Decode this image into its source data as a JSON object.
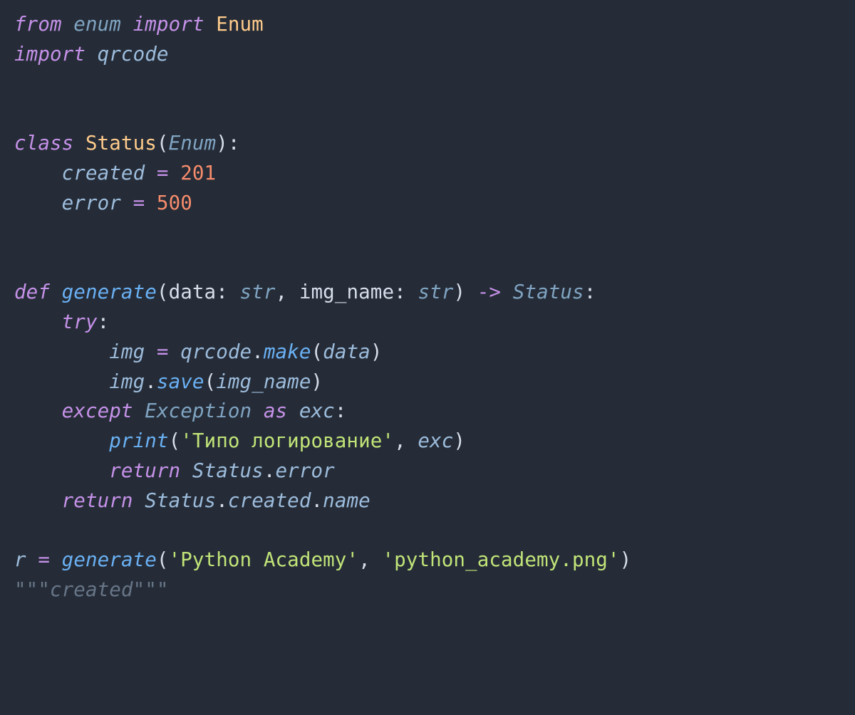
{
  "code": {
    "lines": [
      [
        {
          "t": "from ",
          "c": "kw-ctrl"
        },
        {
          "t": "enum ",
          "c": "type"
        },
        {
          "t": "import ",
          "c": "kw-ctrl"
        },
        {
          "t": "Enum",
          "c": "classname"
        }
      ],
      [
        {
          "t": "import ",
          "c": "kw-ctrl"
        },
        {
          "t": "qrcode",
          "c": "var"
        }
      ],
      [],
      [],
      [
        {
          "t": "class ",
          "c": "kw-ctrl"
        },
        {
          "t": "Status",
          "c": "classname"
        },
        {
          "t": "(",
          "c": "punct"
        },
        {
          "t": "Enum",
          "c": "typeuse"
        },
        {
          "t": "):",
          "c": "punct"
        }
      ],
      [
        {
          "t": "    ",
          "c": "punct"
        },
        {
          "t": "created ",
          "c": "var"
        },
        {
          "t": "= ",
          "c": "op"
        },
        {
          "t": "201",
          "c": "num"
        }
      ],
      [
        {
          "t": "    ",
          "c": "punct"
        },
        {
          "t": "error ",
          "c": "var"
        },
        {
          "t": "= ",
          "c": "op"
        },
        {
          "t": "500",
          "c": "num"
        }
      ],
      [],
      [],
      [
        {
          "t": "def ",
          "c": "kw-ctrl"
        },
        {
          "t": "generate",
          "c": "funcdef"
        },
        {
          "t": "(",
          "c": "punct"
        },
        {
          "t": "data",
          "c": "param"
        },
        {
          "t": ": ",
          "c": "punct"
        },
        {
          "t": "str",
          "c": "type"
        },
        {
          "t": ", ",
          "c": "punct"
        },
        {
          "t": "img_name",
          "c": "param"
        },
        {
          "t": ": ",
          "c": "punct"
        },
        {
          "t": "str",
          "c": "type"
        },
        {
          "t": ") ",
          "c": "punct"
        },
        {
          "t": "-> ",
          "c": "op"
        },
        {
          "t": "Status",
          "c": "typeuse"
        },
        {
          "t": ":",
          "c": "punct"
        }
      ],
      [
        {
          "t": "    ",
          "c": "punct"
        },
        {
          "t": "try",
          "c": "kw-ctrl"
        },
        {
          "t": ":",
          "c": "punct"
        }
      ],
      [
        {
          "t": "        ",
          "c": "punct"
        },
        {
          "t": "img ",
          "c": "var"
        },
        {
          "t": "= ",
          "c": "op"
        },
        {
          "t": "qrcode",
          "c": "var"
        },
        {
          "t": ".",
          "c": "punct"
        },
        {
          "t": "make",
          "c": "method"
        },
        {
          "t": "(",
          "c": "punct"
        },
        {
          "t": "data",
          "c": "var"
        },
        {
          "t": ")",
          "c": "punct"
        }
      ],
      [
        {
          "t": "        ",
          "c": "punct"
        },
        {
          "t": "img",
          "c": "var"
        },
        {
          "t": ".",
          "c": "punct"
        },
        {
          "t": "save",
          "c": "method"
        },
        {
          "t": "(",
          "c": "punct"
        },
        {
          "t": "img_name",
          "c": "var"
        },
        {
          "t": ")",
          "c": "punct"
        }
      ],
      [
        {
          "t": "    ",
          "c": "punct"
        },
        {
          "t": "except ",
          "c": "kw-ctrl"
        },
        {
          "t": "Exception ",
          "c": "typeuse"
        },
        {
          "t": "as ",
          "c": "kw-ctrl"
        },
        {
          "t": "exc",
          "c": "var"
        },
        {
          "t": ":",
          "c": "punct"
        }
      ],
      [
        {
          "t": "        ",
          "c": "punct"
        },
        {
          "t": "print",
          "c": "funccall"
        },
        {
          "t": "(",
          "c": "punct"
        },
        {
          "t": "'Типо логирование'",
          "c": "str"
        },
        {
          "t": ", ",
          "c": "punct"
        },
        {
          "t": "exc",
          "c": "var"
        },
        {
          "t": ")",
          "c": "punct"
        }
      ],
      [
        {
          "t": "        ",
          "c": "punct"
        },
        {
          "t": "return ",
          "c": "kw-ctrl"
        },
        {
          "t": "Status",
          "c": "var"
        },
        {
          "t": ".",
          "c": "punct"
        },
        {
          "t": "error",
          "c": "var"
        }
      ],
      [
        {
          "t": "    ",
          "c": "punct"
        },
        {
          "t": "return ",
          "c": "kw-ctrl"
        },
        {
          "t": "Status",
          "c": "var"
        },
        {
          "t": ".",
          "c": "punct"
        },
        {
          "t": "created",
          "c": "var"
        },
        {
          "t": ".",
          "c": "punct"
        },
        {
          "t": "name",
          "c": "var"
        }
      ],
      [],
      [
        {
          "t": "r ",
          "c": "var"
        },
        {
          "t": "= ",
          "c": "op"
        },
        {
          "t": "generate",
          "c": "funccall"
        },
        {
          "t": "(",
          "c": "punct"
        },
        {
          "t": "'Python Academy'",
          "c": "str"
        },
        {
          "t": ", ",
          "c": "punct"
        },
        {
          "t": "'python_academy.png'",
          "c": "str"
        },
        {
          "t": ")",
          "c": "punct"
        }
      ],
      [
        {
          "t": "\"\"\"created\"\"\"",
          "c": "comment"
        }
      ]
    ]
  }
}
